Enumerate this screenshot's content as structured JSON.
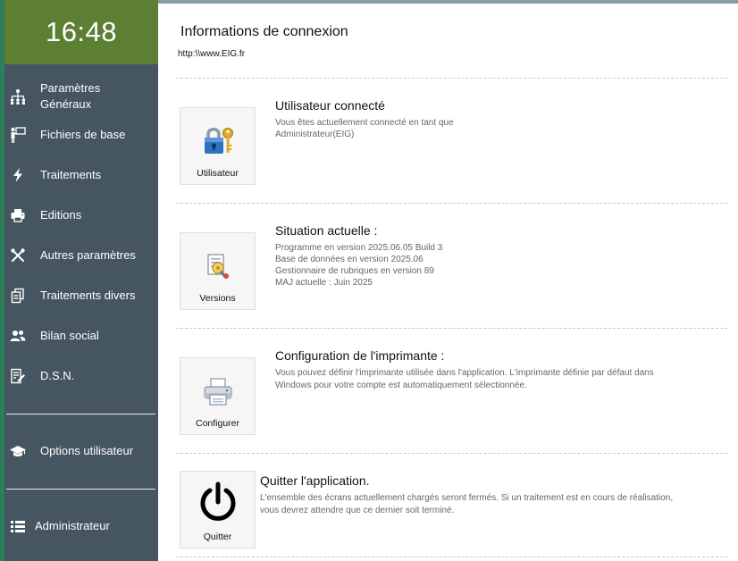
{
  "clock": "16:48",
  "sidebar": {
    "items": [
      {
        "icon": "org-chart-icon",
        "label": "Paramètres Généraux"
      },
      {
        "icon": "presenter-icon",
        "label": "Fichiers de base"
      },
      {
        "icon": "lightning-icon",
        "label": "Traitements"
      },
      {
        "icon": "printer-icon",
        "label": "Editions"
      },
      {
        "icon": "tools-icon",
        "label": "Autres paramètres"
      },
      {
        "icon": "documents-icon",
        "label": "Traitements divers"
      },
      {
        "icon": "users-icon",
        "label": "Bilan social"
      },
      {
        "icon": "edit-document-icon",
        "label": "D.S.N."
      }
    ],
    "options": {
      "icon": "graduation-cap-icon",
      "label": "Options utilisateur"
    },
    "user": {
      "icon": "list-icon",
      "label": "Administrateur"
    }
  },
  "main": {
    "title": "Informations de connexion",
    "url": "http:\\\\www.EIG.fr",
    "sections": [
      {
        "tile_label": "Utilisateur",
        "tile_icon": "lock-key-icon",
        "title": "Utilisateur connecté",
        "lines": [
          "Vous êtes actuellement connecté en tant que",
          "Administrateur(EIG)"
        ]
      },
      {
        "tile_label": "Versions",
        "tile_icon": "versions-icon",
        "title": "Situation actuelle :",
        "lines": [
          "Programme en version 2025.06.05 Build 3",
          "Base de données en version 2025.06",
          "Gestionnaire de rubriques en version 89",
          "MAJ actuelle : Juin 2025"
        ]
      },
      {
        "tile_label": "Configurer",
        "tile_icon": "printer-icon",
        "title": "Configuration de l'imprimante :",
        "lines": [
          "Vous pouvez définir l'imprimante utilisée dans l'application. L'imprimante définie par défaut dans",
          "Windows pour votre compte est automatiquement sélectionnée."
        ]
      },
      {
        "tile_label": "Quitter",
        "tile_icon": "power-icon",
        "title": "Quitter l'application.",
        "lines": [
          "L'ensemble des écrans actuellement chargés seront fermés. Si un traitement est en cours de réalisation,",
          "vous devrez attendre que ce dernier soit terminé."
        ]
      }
    ]
  },
  "colors": {
    "sidebar": "#455660",
    "clock_bg": "#5d7f33",
    "accent_edge": "#2e7d5b"
  }
}
